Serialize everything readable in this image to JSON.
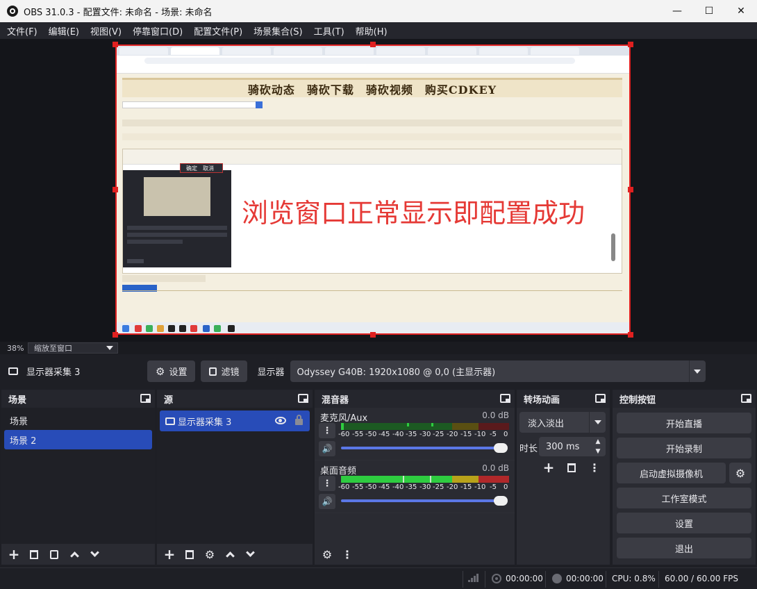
{
  "window": {
    "title": "OBS 31.0.3 - 配置文件: 未命名 - 场景: 未命名",
    "minimize_glyph": "—",
    "maximize_glyph": "☐",
    "close_glyph": "✕"
  },
  "menu": [
    "文件(F)",
    "编辑(E)",
    "视图(V)",
    "停靠窗口(D)",
    "配置文件(P)",
    "场景集合(S)",
    "工具(T)",
    "帮助(H)"
  ],
  "preview": {
    "banner_text": "骑砍动态　骑砍下载　骑砍视频　购买CDKEY",
    "overlay_text": "浏览窗口正常显示即配置成功",
    "popup_text": "确定　取消"
  },
  "zoom": {
    "percent": "38%",
    "mode": "缩放至窗口"
  },
  "source_toolbar": {
    "source_name": "显示器采集 3",
    "settings_label": "设置",
    "filters_label": "滤镜",
    "display_label": "显示器",
    "display_value": "Odyssey G40B: 1920x1080 @ 0,0 (主显示器)"
  },
  "scenes": {
    "title": "场景",
    "items": [
      "场景",
      "场景 2"
    ],
    "selected_index": 1
  },
  "sources": {
    "title": "源",
    "items": [
      "显示器采集 3"
    ]
  },
  "mixer": {
    "title": "混音器",
    "channels": [
      {
        "name": "麦克风/Aux",
        "db": "0.0 dB",
        "level": 0.0
      },
      {
        "name": "桌面音频",
        "db": "0.0 dB",
        "level": 0.0
      }
    ],
    "ticks": [
      "-60",
      "-55",
      "-50",
      "-45",
      "-40",
      "-35",
      "-30",
      "-25",
      "-20",
      "-15",
      "-10",
      "-5",
      "0"
    ],
    "colors": {
      "green": "#2ecc40",
      "yellow": "#b8a21a",
      "red": "#b0282a",
      "green_dark": "#1c5a22",
      "yellow_dark": "#5a4f12",
      "red_dark": "#5a1a1c"
    }
  },
  "transitions": {
    "title": "转场动画",
    "selected": "淡入淡出",
    "duration_label": "时长",
    "duration_value": "300 ms"
  },
  "controls": {
    "title": "控制按钮",
    "buttons": [
      "开始直播",
      "开始录制",
      "启动虚拟摄像机",
      "工作室模式",
      "设置",
      "退出"
    ]
  },
  "status": {
    "stream_time": "00:00:00",
    "record_time": "00:00:00",
    "cpu": "CPU: 0.8%",
    "fps": "60.00 / 60.00 FPS"
  },
  "colors": {
    "accent": "#284cb8",
    "selection_border": "#e02020"
  }
}
